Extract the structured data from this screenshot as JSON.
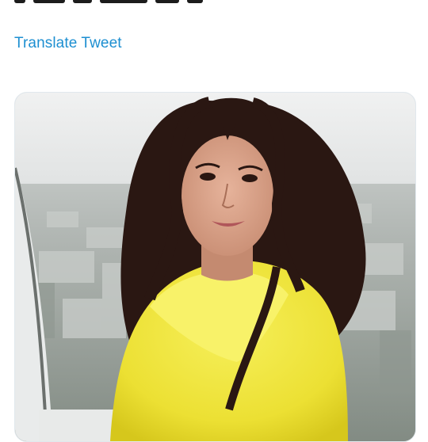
{
  "tweet": {
    "translate_label": "Translate Tweet"
  },
  "media": {
    "type": "photo",
    "colors": {
      "sky": "#e6e8e8",
      "coat": "#f1e83a",
      "hair": "#2a1712",
      "skin": "#d9a48a"
    }
  }
}
